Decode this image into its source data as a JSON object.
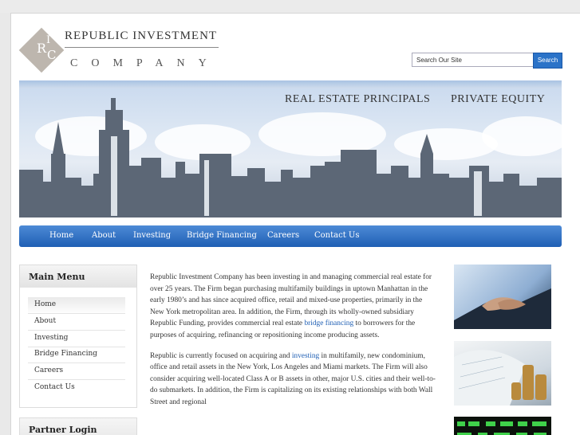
{
  "site": {
    "logo_letters": [
      "R",
      "I",
      "C"
    ],
    "title": "REPUBLIC INVESTMENT",
    "subtitle": "COMPANY"
  },
  "search": {
    "value": "Search Our Site",
    "button": "Search"
  },
  "banner": {
    "tag_left": "REAL ESTATE PRINCIPALS",
    "tag_right": "PRIVATE EQUITY"
  },
  "nav": {
    "items": [
      "Home",
      "About",
      "Investing",
      "Bridge Financing",
      "Careers",
      "Contact Us"
    ]
  },
  "sidebar": {
    "title": "Main Menu",
    "items": [
      "Home",
      "About",
      "Investing",
      "Bridge Financing",
      "Careers",
      "Contact Us"
    ],
    "partner_title": "Partner Login"
  },
  "content": {
    "p1_a": "Republic Investment Company has been investing in and managing commercial real estate for over 25 years. The Firm began purchasing multifamily buildings in uptown Manhattan in the early 1980’s and has since acquired office, retail and mixed-use properties, primarily in the New York metropolitan area. In addition, the Firm, through its wholly-owned subsidiary Republic Funding, provides commercial real estate ",
    "p1_link": "bridge financing",
    "p1_b": " to borrowers for the purposes of acquiring, refinancing or repositioning income producing assets.",
    "p2_a": "Republic is currently focused on acquiring and ",
    "p2_link": "investing",
    "p2_b": " in multifamily, new condominium, office and retail assets in the New York, Los Angeles and Miami markets. The Firm will also consider acquiring well-located Class A or B assets in other, major U.S. cities and their well-to-do submarkets. In addition, the Firm is capitalizing on its existing relationships with both Wall Street and regional"
  },
  "colors": {
    "nav_blue": "#1f5fb4",
    "link_blue": "#1f5fb4",
    "search_button": "#2b73c8"
  },
  "icons": {
    "logo": "ric-diamond-logo"
  }
}
